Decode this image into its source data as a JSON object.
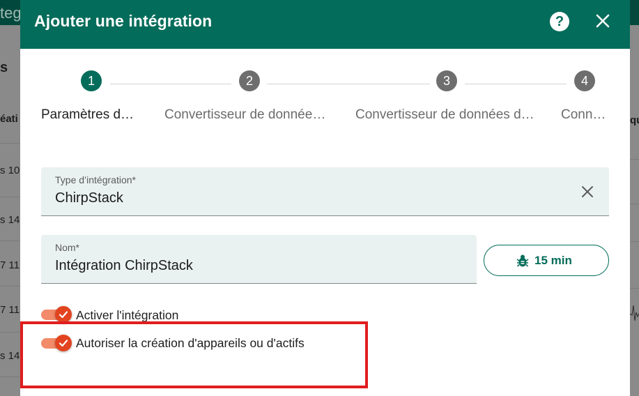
{
  "background": {
    "topbar_title": "teg",
    "left_texts": [
      "s",
      "éati",
      "s 10:",
      "s 14:",
      "7 11:",
      "7 11:",
      "s 14:"
    ],
    "right_text": "qu"
  },
  "dialog": {
    "title": "Ajouter une intégration",
    "help_label": "?",
    "steps": [
      {
        "number": "1",
        "label": "Paramètres de base",
        "state": "active"
      },
      {
        "number": "2",
        "label": "Convertisseur de données de liaison montante",
        "state": "inactive"
      },
      {
        "number": "3",
        "label": "Convertisseur de données descendantes",
        "state": "inactive"
      },
      {
        "number": "4",
        "label": "Connexion",
        "state": "inactive"
      }
    ],
    "integration_type": {
      "label": "Type d’intégration*",
      "value": "ChirpStack"
    },
    "name": {
      "label": "Nom*",
      "value": "Intégration ChirpStack"
    },
    "debug_button": {
      "icon": "bug-icon",
      "label": "15 min"
    },
    "toggles": [
      {
        "label": "Activer l'intégration",
        "checked": true
      },
      {
        "label": "Autoriser la création d'appareils ou d'actifs",
        "checked": true
      }
    ]
  },
  "colors": {
    "primary": "#046c5a",
    "toggle_thumb": "#e2441f",
    "toggle_track": "#f28b6a",
    "highlight": "#e01e1e"
  }
}
